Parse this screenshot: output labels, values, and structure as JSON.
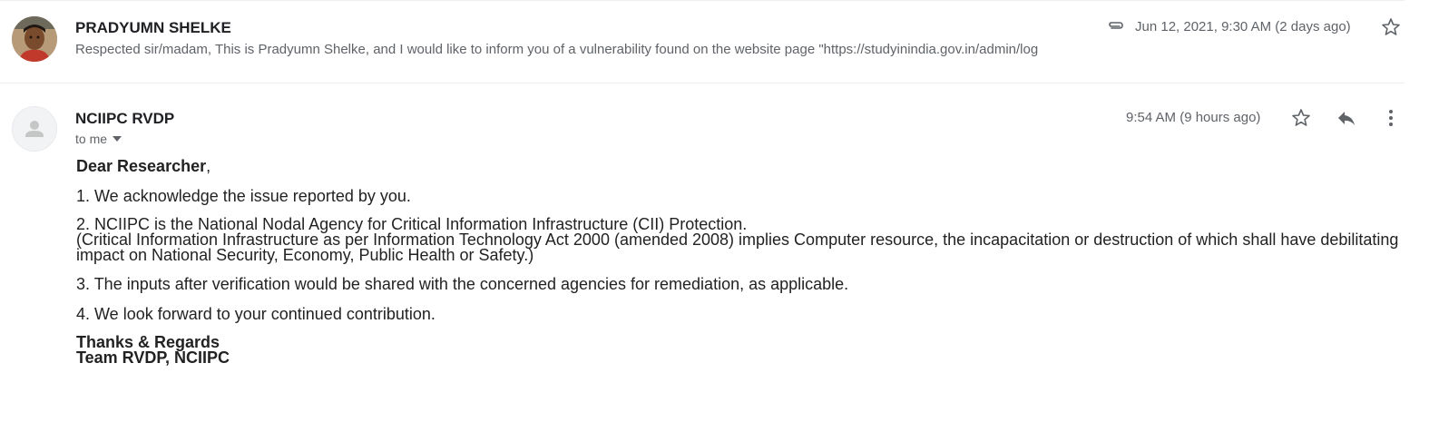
{
  "messages": [
    {
      "sender": "PRADYUMN SHELKE",
      "snippet": "Respected sir/madam, This is Pradyumn Shelke, and I would like to inform you of a vulnerability found on the website page \"https://studyinindia.gov.in/admin/log",
      "timestamp": "Jun 12, 2021, 9:30 AM (2 days ago)",
      "has_attachment": true,
      "icons": [
        "attachment-icon",
        "star-icon"
      ]
    },
    {
      "sender": "NCIIPC RVDP",
      "recipient": "to me",
      "timestamp": "9:54 AM (9 hours ago)",
      "icons": [
        "star-icon",
        "reply-icon",
        "more-vert-icon",
        "dropdown-icon"
      ],
      "body": {
        "greeting_bold": "Dear Researcher",
        "greeting_rest": ",",
        "p1": "1. We acknowledge the issue reported by you.",
        "p2_line1": "2. NCIIPC is the National Nodal Agency for Critical Information Infrastructure (CII) Protection.",
        "p2_line2": "(Critical Information Infrastructure as per Information Technology Act 2000 (amended 2008) implies Computer resource, the incapacitation or destruction of which shall have debilitating impact on National Security, Economy, Public Health or Safety.)",
        "p3": "3. The inputs after verification would be shared with the concerned agencies for remediation, as applicable.",
        "p4": "4. We look forward to your continued contribution.",
        "sig_line1": "Thanks & Regards",
        "sig_line2": "Team RVDP, NCIIPC"
      }
    }
  ],
  "colors": {
    "text": "#202124",
    "secondary": "#5f6368",
    "divider": "#eceff1"
  }
}
